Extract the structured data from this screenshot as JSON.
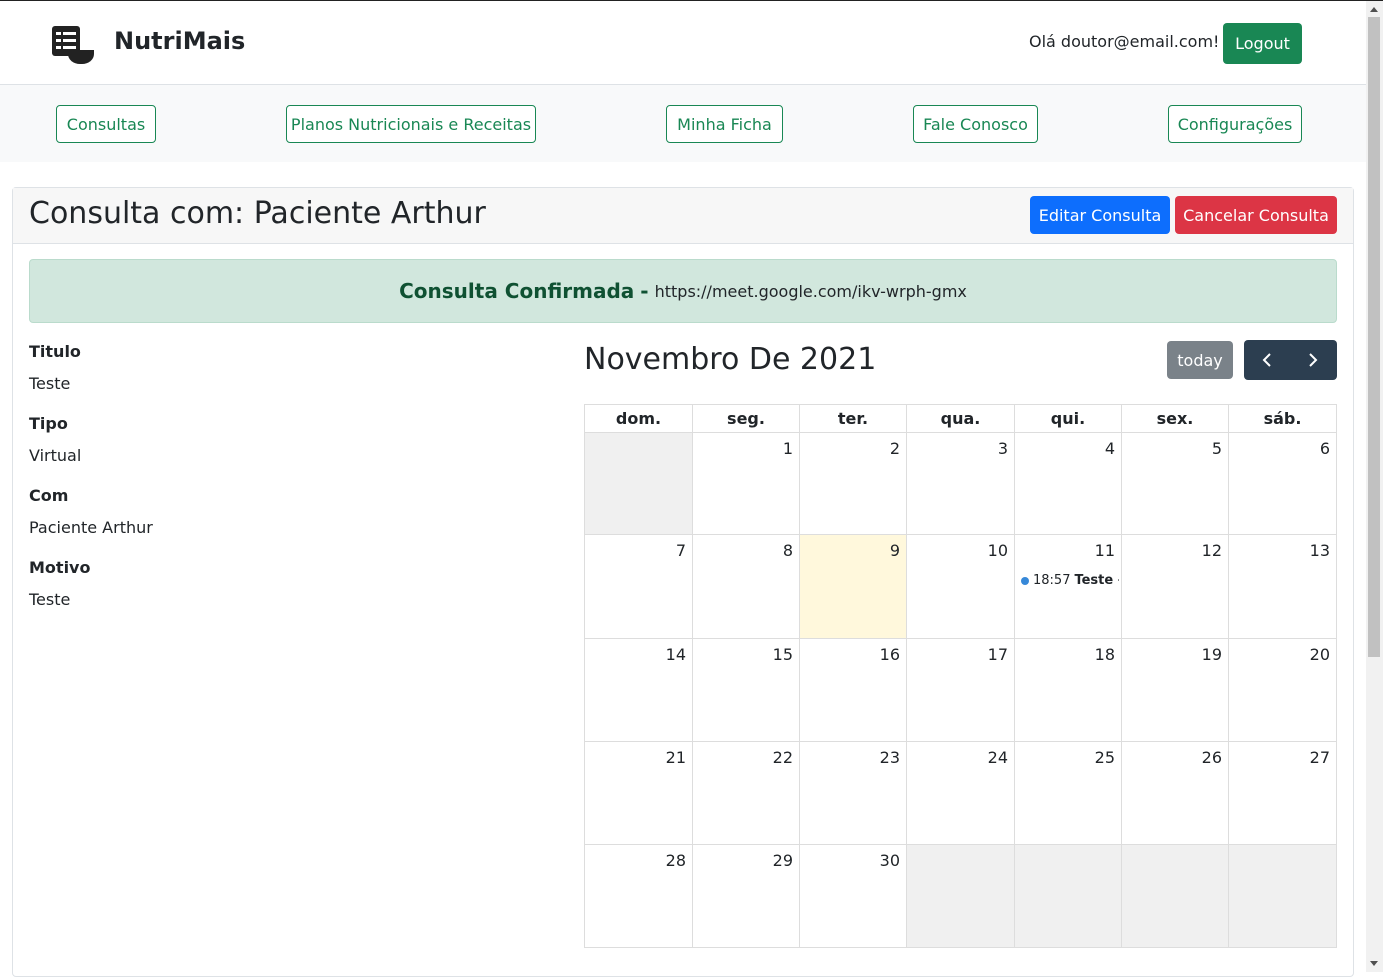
{
  "brand": {
    "name": "NutriMais",
    "logo_icon": "table-bowl-logo-icon"
  },
  "header": {
    "greeting": "Olá doutor@email.com!",
    "logout_label": "Logout"
  },
  "nav": {
    "items": [
      {
        "label": "Consultas"
      },
      {
        "label": "Planos Nutricionais e Receitas"
      },
      {
        "label": "Minha Ficha"
      },
      {
        "label": "Fale Conosco"
      },
      {
        "label": "Configurações"
      }
    ]
  },
  "consulta": {
    "title": "Consulta com: Paciente Arthur",
    "edit_label": "Editar Consulta",
    "cancel_label": "Cancelar Consulta",
    "status": "Consulta Confirmada",
    "separator": "-",
    "link": "https://meet.google.com/ikv-wrph-gmx",
    "details": [
      {
        "label": "Titulo",
        "value": "Teste"
      },
      {
        "label": "Tipo",
        "value": "Virtual"
      },
      {
        "label": "Com",
        "value": "Paciente Arthur"
      },
      {
        "label": "Motivo",
        "value": "Teste"
      }
    ]
  },
  "calendar": {
    "title": "Novembro De 2021",
    "today_label": "today",
    "prev_icon": "chevron-left-icon",
    "next_icon": "chevron-right-icon",
    "weekdays": [
      "dom.",
      "seg.",
      "ter.",
      "qua.",
      "qui.",
      "sex.",
      "sáb."
    ],
    "weeks": [
      [
        "",
        "1",
        "2",
        "3",
        "4",
        "5",
        "6"
      ],
      [
        "7",
        "8",
        "9",
        "10",
        "11",
        "12",
        "13"
      ],
      [
        "14",
        "15",
        "16",
        "17",
        "18",
        "19",
        "20"
      ],
      [
        "21",
        "22",
        "23",
        "24",
        "25",
        "26",
        "27"
      ],
      [
        "28",
        "29",
        "30",
        "",
        "",
        "",
        ""
      ]
    ],
    "today": "9",
    "event": {
      "day": "11",
      "time": "18:57",
      "title": "Teste - P"
    }
  },
  "colors": {
    "brand_green": "#198754",
    "primary": "#0d6efd",
    "danger": "#dc3545",
    "today_bg": "#fff8dc"
  }
}
